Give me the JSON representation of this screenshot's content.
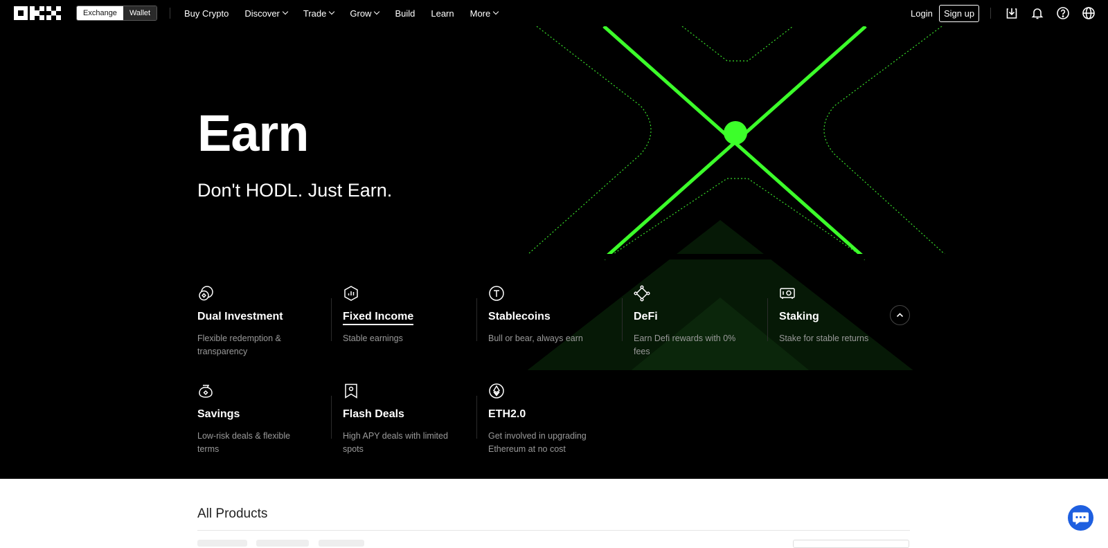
{
  "nav": {
    "segment": {
      "exchange": "Exchange",
      "wallet": "Wallet"
    },
    "menu": [
      {
        "label": "Buy Crypto",
        "dropdown": false
      },
      {
        "label": "Discover",
        "dropdown": true
      },
      {
        "label": "Trade",
        "dropdown": true
      },
      {
        "label": "Grow",
        "dropdown": true
      },
      {
        "label": "Build",
        "dropdown": false
      },
      {
        "label": "Learn",
        "dropdown": false
      },
      {
        "label": "More",
        "dropdown": true
      }
    ],
    "login": "Login",
    "signup": "Sign up",
    "icons": [
      "download-icon",
      "bell-icon",
      "help-icon",
      "globe-icon"
    ]
  },
  "hero": {
    "title": "Earn",
    "subtitle": "Don't HODL. Just Earn.",
    "accent": "#3cff2a"
  },
  "products": [
    {
      "icon": "dual-investment-icon",
      "title": "Dual Investment",
      "desc": "Flexible redemption & transparency",
      "active": false
    },
    {
      "icon": "fixed-income-icon",
      "title": "Fixed Income",
      "desc": "Stable earnings",
      "active": true
    },
    {
      "icon": "stablecoin-icon",
      "title": "Stablecoins",
      "desc": "Bull or bear, always earn",
      "active": false
    },
    {
      "icon": "defi-icon",
      "title": "DeFi",
      "desc": "Earn Defi rewards with 0% fees",
      "active": false
    },
    {
      "icon": "staking-icon",
      "title": "Staking",
      "desc": "Stake for stable returns",
      "active": false
    },
    {
      "icon": "savings-icon",
      "title": "Savings",
      "desc": "Low-risk deals & flexible terms",
      "active": false
    },
    {
      "icon": "flash-deals-icon",
      "title": "Flash Deals",
      "desc": "High APY deals with limited spots",
      "active": false
    },
    {
      "icon": "eth-icon",
      "title": "ETH2.0",
      "desc": "Get involved in upgrading Ethereum at no cost",
      "active": false
    }
  ],
  "section": {
    "title": "All Products"
  },
  "chat": {
    "icon": "chat-icon",
    "color": "#1e5fe0"
  }
}
